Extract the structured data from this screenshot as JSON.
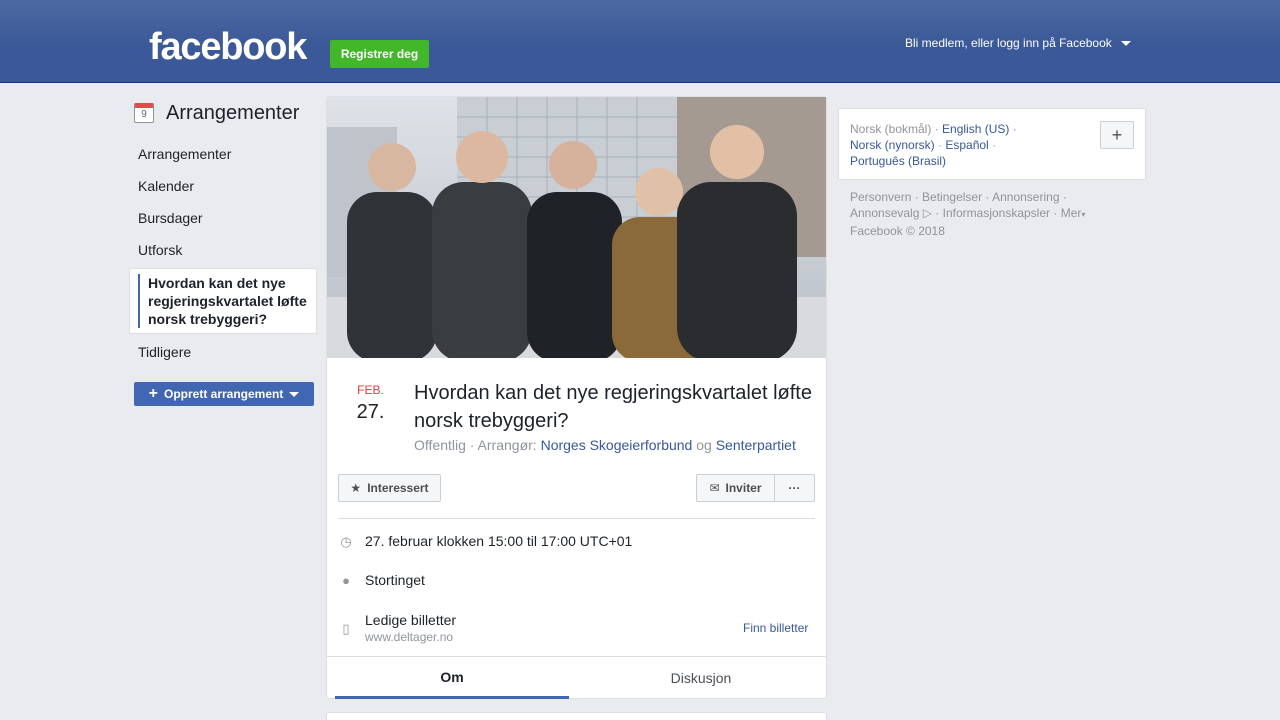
{
  "header": {
    "logo": "facebook",
    "register_label": "Registrer deg",
    "login_label": "Bli medlem, eller logg inn på Facebook"
  },
  "sidebar": {
    "calendar_day": "9",
    "title": "Arrangementer",
    "items": [
      {
        "label": "Arrangementer"
      },
      {
        "label": "Kalender"
      },
      {
        "label": "Bursdager"
      },
      {
        "label": "Utforsk"
      }
    ],
    "active_item": "Hvordan kan det nye regjeringskvartalet løfte norsk trebyggeri?",
    "after_item": "Tidligere",
    "create_label": "Opprett arrangement"
  },
  "event": {
    "month": "FEB.",
    "day": "27.",
    "title": "Hvordan kan det nye regjeringskvartalet løfte norsk trebyggeri?",
    "visibility": "Offentlig · Arrangør:",
    "organizer1": "Norges Skogeierforbund",
    "conjunction": "og",
    "organizer2": "Senterpartiet",
    "interested_label": "Interessert",
    "invite_label": "Inviter",
    "more_label": "···",
    "time": "27. februar klokken 15:00 til 17:00 UTC+01",
    "location": "Stortinget",
    "tickets_label": "Ledige billetter",
    "tickets_url": "www.deltager.no",
    "find_tickets": "Finn billetter",
    "tabs": [
      {
        "label": "Om",
        "active": true
      },
      {
        "label": "Diskusjon",
        "active": false
      }
    ]
  },
  "languages": {
    "current": "Norsk (bokmål)",
    "options": [
      "English (US)",
      "Norsk (nynorsk)",
      "Español",
      "Português (Brasil)"
    ],
    "add_label": "+"
  },
  "footer": {
    "links": [
      "Personvern",
      "Betingelser",
      "Annonsering",
      "Annonsevalg",
      "Informasjonskapsler",
      "Mer"
    ],
    "copyright": "Facebook © 2018"
  },
  "colors": {
    "brand": "#3b5998",
    "green": "#42b72a",
    "link": "#385898",
    "accent": "#4267b2",
    "date_red": "#e0393e"
  }
}
